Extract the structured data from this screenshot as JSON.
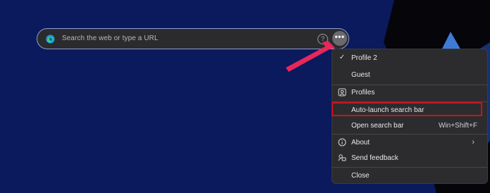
{
  "search": {
    "placeholder": "Search the web or type a URL",
    "help_icon": "help-circle-icon",
    "help_symbol": "?",
    "more_icon": "more-horizontal-icon",
    "more_symbol": "•••"
  },
  "menu": {
    "items": [
      {
        "label": "Profile 2",
        "checked": true,
        "icon": "checkmark-icon"
      },
      {
        "label": "Guest"
      },
      {
        "label": "Profiles",
        "icon": "profiles-icon"
      },
      {
        "label": "Auto-launch search bar",
        "highlighted": true
      },
      {
        "label": "Open search bar",
        "shortcut": "Win+Shift+F"
      },
      {
        "label": "About",
        "icon": "info-icon",
        "submenu": true
      },
      {
        "label": "Send feedback",
        "icon": "feedback-icon"
      },
      {
        "label": "Close"
      }
    ]
  },
  "colors": {
    "background": "#0a1a5c",
    "menu_bg": "#2c2c2e",
    "highlight": "#d0101a",
    "arrow": "#e8275a"
  }
}
